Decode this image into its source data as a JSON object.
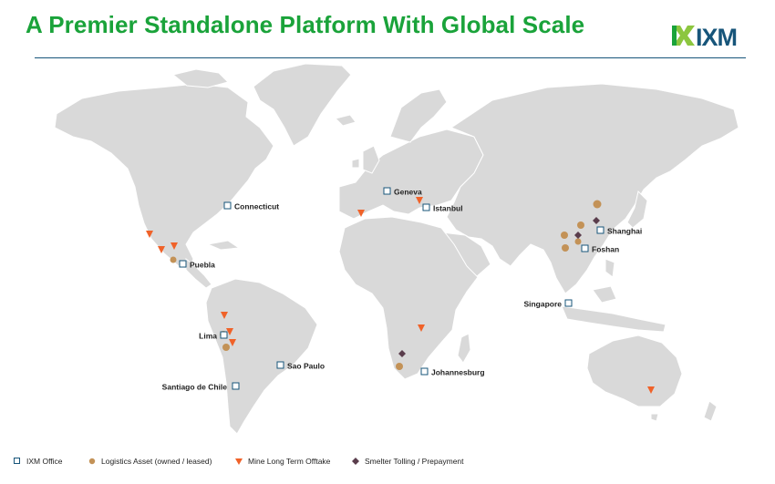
{
  "title": "A Premier Standalone Platform With Global Scale",
  "logo": "IXM",
  "colors": {
    "title": "#1aa33a",
    "brand_blue": "#17557a",
    "land": "#d9d9d9",
    "logistics": "#c39257",
    "mine": "#f06229",
    "smelter": "#5a3d4c"
  },
  "offices": [
    "Connecticut",
    "Puebla",
    "Lima",
    "Sao Paulo",
    "Santiago de Chile",
    "Geneva",
    "Istanbul",
    "Johannesburg",
    "Singapore",
    "Shanghai",
    "Foshan"
  ],
  "legend": {
    "office": "IXM Office",
    "logistics": "Logistics Asset (owned / leased)",
    "mine": "Mine Long Term Offtake",
    "smelter": "Smelter Tolling / Prepayment"
  }
}
